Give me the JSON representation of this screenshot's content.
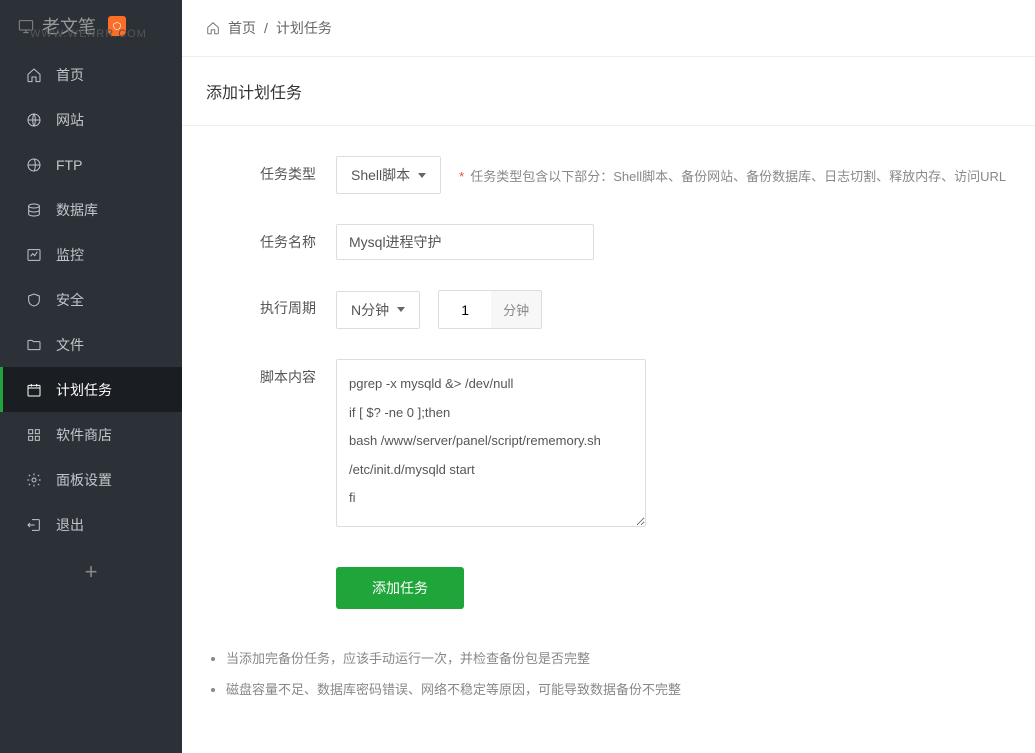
{
  "header": {
    "logo_text": "老文笔",
    "watermark": "WWW.WENRR.COM"
  },
  "sidebar": {
    "items": [
      {
        "label": "首页",
        "icon": "home-icon"
      },
      {
        "label": "网站",
        "icon": "globe-icon"
      },
      {
        "label": "FTP",
        "icon": "ftp-icon"
      },
      {
        "label": "数据库",
        "icon": "database-icon"
      },
      {
        "label": "监控",
        "icon": "monitor-icon"
      },
      {
        "label": "安全",
        "icon": "shield-icon"
      },
      {
        "label": "文件",
        "icon": "folder-icon"
      },
      {
        "label": "计划任务",
        "icon": "calendar-icon",
        "active": true
      },
      {
        "label": "软件商店",
        "icon": "apps-icon"
      },
      {
        "label": "面板设置",
        "icon": "gear-icon"
      },
      {
        "label": "退出",
        "icon": "logout-icon"
      }
    ]
  },
  "breadcrumb": {
    "home": "首页",
    "sep": "/",
    "current": "计划任务"
  },
  "panel": {
    "title": "添加计划任务"
  },
  "form": {
    "task_type": {
      "label": "任务类型",
      "value": "Shell脚本",
      "hint": "任务类型包含以下部分：Shell脚本、备份网站、备份数据库、日志切割、释放内存、访问URL"
    },
    "task_name": {
      "label": "任务名称",
      "value": "Mysql进程守护"
    },
    "period": {
      "label": "执行周期",
      "value": "N分钟",
      "num": "1",
      "unit": "分钟"
    },
    "script": {
      "label": "脚本内容",
      "value": "pgrep -x mysqld &> /dev/null\nif [ $? -ne 0 ];then\nbash /www/server/panel/script/rememory.sh\n/etc/init.d/mysqld start\nfi"
    },
    "submit": "添加任务"
  },
  "notes": {
    "items": [
      "当添加完备份任务，应该手动运行一次，并检查备份包是否完整",
      "磁盘容量不足、数据库密码错误、网络不稳定等原因，可能导致数据备份不完整"
    ]
  }
}
